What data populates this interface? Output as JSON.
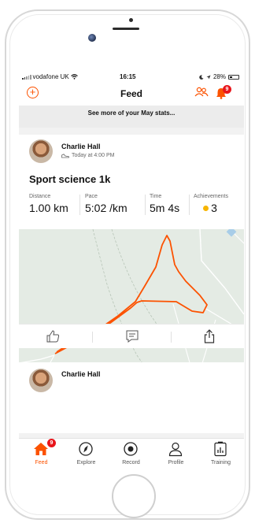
{
  "status_bar": {
    "carrier": "vodafone UK",
    "time": "16:15",
    "battery": "28%"
  },
  "header": {
    "title": "Feed",
    "notification_count": "9"
  },
  "banner": {
    "text": "See more of your May stats..."
  },
  "activity": {
    "athlete": "Charlie Hall",
    "time": "Today at 4:00 PM",
    "title": "Sport science 1k",
    "stats": [
      {
        "label": "Distance",
        "value": "1.00 km"
      },
      {
        "label": "Pace",
        "value": "5:02 /km"
      },
      {
        "label": "Time",
        "value": "5m 4s"
      },
      {
        "label": "Achievements",
        "value": "3"
      }
    ]
  },
  "next_activity": {
    "athlete": "Charlie Hall"
  },
  "tab_bar": {
    "badge": "9",
    "tabs": [
      {
        "label": "Feed"
      },
      {
        "label": "Explore"
      },
      {
        "label": "Record"
      },
      {
        "label": "Profile"
      },
      {
        "label": "Training"
      }
    ]
  },
  "colors": {
    "accent": "#fc5200",
    "badge": "#e8151b",
    "route": "#fc5200",
    "map_bg": "#e4ebe4"
  }
}
